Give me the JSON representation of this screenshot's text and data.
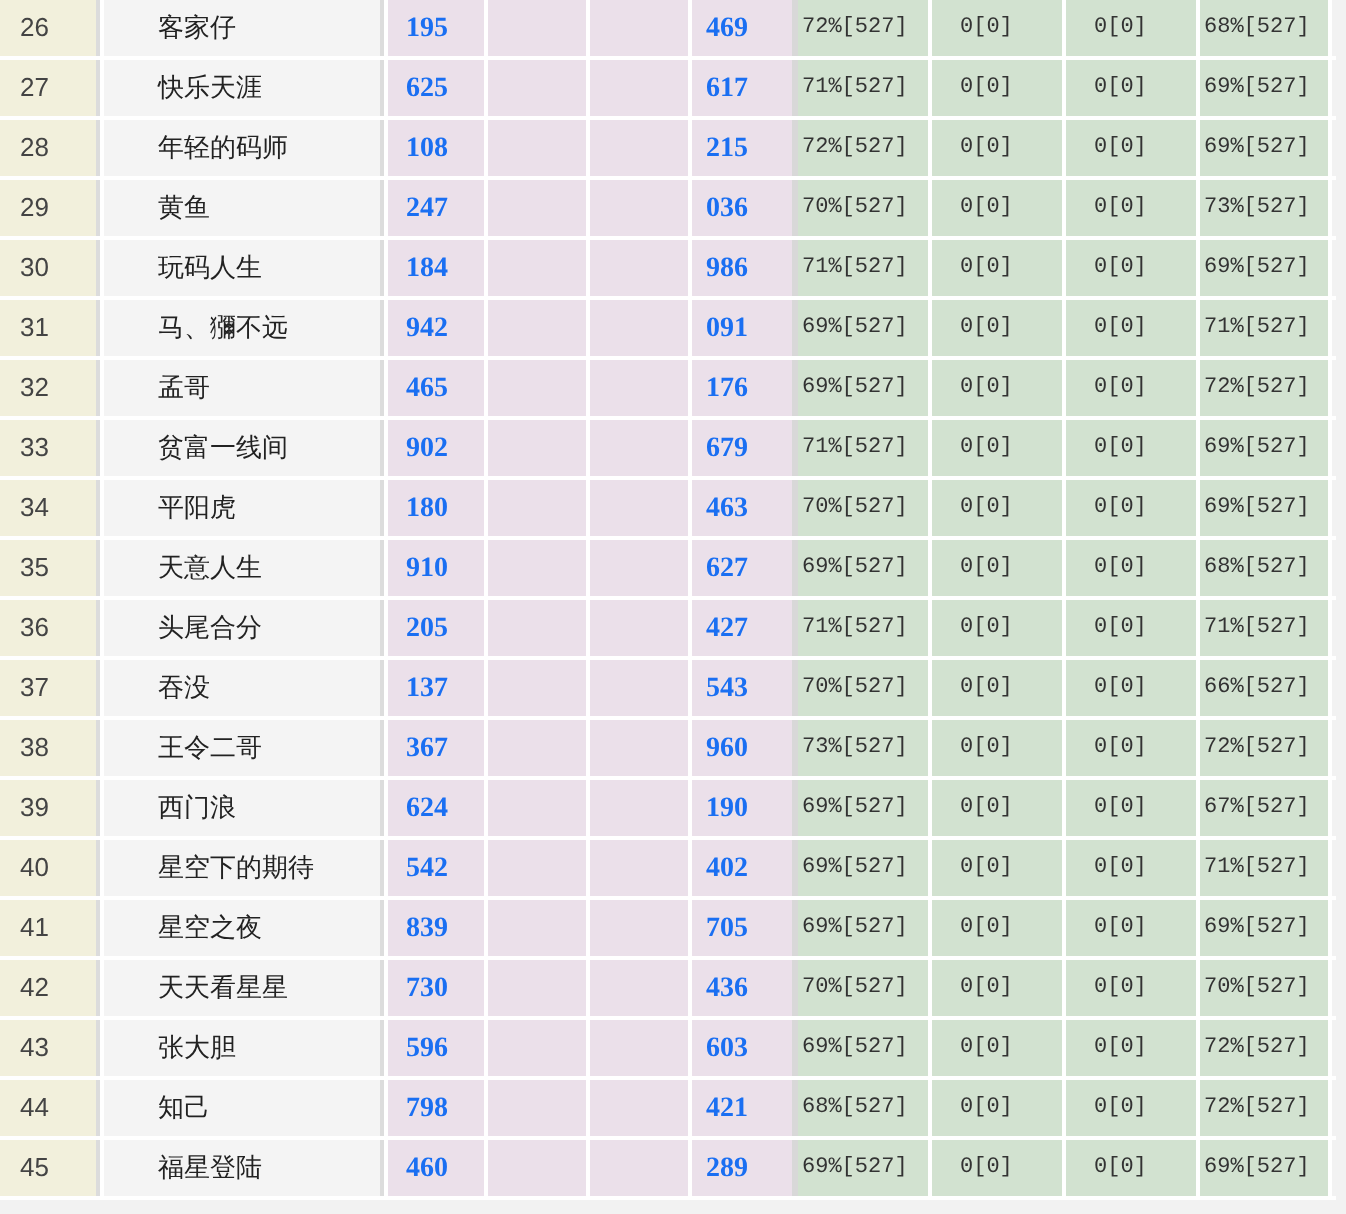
{
  "table": {
    "rows": [
      {
        "rank": "26",
        "name": "客家仔",
        "value_1": "195",
        "value_2": "469",
        "stats": [
          "72%[527]",
          "0[0]",
          "0[0]",
          "68%[527]"
        ]
      },
      {
        "rank": "27",
        "name": "快乐天涯",
        "value_1": "625",
        "value_2": "617",
        "stats": [
          "71%[527]",
          "0[0]",
          "0[0]",
          "69%[527]"
        ]
      },
      {
        "rank": "28",
        "name": "年轻的码师",
        "value_1": "108",
        "value_2": "215",
        "stats": [
          "72%[527]",
          "0[0]",
          "0[0]",
          "69%[527]"
        ]
      },
      {
        "rank": "29",
        "name": "黄鱼",
        "value_1": "247",
        "value_2": "036",
        "stats": [
          "70%[527]",
          "0[0]",
          "0[0]",
          "73%[527]"
        ]
      },
      {
        "rank": "30",
        "name": "玩码人生",
        "value_1": "184",
        "value_2": "986",
        "stats": [
          "71%[527]",
          "0[0]",
          "0[0]",
          "69%[527]"
        ]
      },
      {
        "rank": "31",
        "name": "马、獼不远",
        "value_1": "942",
        "value_2": "091",
        "stats": [
          "69%[527]",
          "0[0]",
          "0[0]",
          "71%[527]"
        ]
      },
      {
        "rank": "32",
        "name": "孟哥",
        "value_1": "465",
        "value_2": "176",
        "stats": [
          "69%[527]",
          "0[0]",
          "0[0]",
          "72%[527]"
        ]
      },
      {
        "rank": "33",
        "name": "贫富一线间",
        "value_1": "902",
        "value_2": "679",
        "stats": [
          "71%[527]",
          "0[0]",
          "0[0]",
          "69%[527]"
        ]
      },
      {
        "rank": "34",
        "name": "平阳虎",
        "value_1": "180",
        "value_2": "463",
        "stats": [
          "70%[527]",
          "0[0]",
          "0[0]",
          "69%[527]"
        ]
      },
      {
        "rank": "35",
        "name": "天意人生",
        "value_1": "910",
        "value_2": "627",
        "stats": [
          "69%[527]",
          "0[0]",
          "0[0]",
          "68%[527]"
        ]
      },
      {
        "rank": "36",
        "name": "头尾合分",
        "value_1": "205",
        "value_2": "427",
        "stats": [
          "71%[527]",
          "0[0]",
          "0[0]",
          "71%[527]"
        ]
      },
      {
        "rank": "37",
        "name": "吞没",
        "value_1": "137",
        "value_2": "543",
        "stats": [
          "70%[527]",
          "0[0]",
          "0[0]",
          "66%[527]"
        ]
      },
      {
        "rank": "38",
        "name": "王令二哥",
        "value_1": "367",
        "value_2": "960",
        "stats": [
          "73%[527]",
          "0[0]",
          "0[0]",
          "72%[527]"
        ]
      },
      {
        "rank": "39",
        "name": "西门浪",
        "value_1": "624",
        "value_2": "190",
        "stats": [
          "69%[527]",
          "0[0]",
          "0[0]",
          "67%[527]"
        ]
      },
      {
        "rank": "40",
        "name": "星空下的期待",
        "value_1": "542",
        "value_2": "402",
        "stats": [
          "69%[527]",
          "0[0]",
          "0[0]",
          "71%[527]"
        ]
      },
      {
        "rank": "41",
        "name": "星空之夜",
        "value_1": "839",
        "value_2": "705",
        "stats": [
          "69%[527]",
          "0[0]",
          "0[0]",
          "69%[527]"
        ]
      },
      {
        "rank": "42",
        "name": "天天看星星",
        "value_1": "730",
        "value_2": "436",
        "stats": [
          "70%[527]",
          "0[0]",
          "0[0]",
          "70%[527]"
        ]
      },
      {
        "rank": "43",
        "name": "张大胆",
        "value_1": "596",
        "value_2": "603",
        "stats": [
          "69%[527]",
          "0[0]",
          "0[0]",
          "72%[527]"
        ]
      },
      {
        "rank": "44",
        "name": "知己",
        "value_1": "798",
        "value_2": "421",
        "stats": [
          "68%[527]",
          "0[0]",
          "0[0]",
          "72%[527]"
        ]
      },
      {
        "rank": "45",
        "name": "福星登陆",
        "value_1": "460",
        "value_2": "289",
        "stats": [
          "69%[527]",
          "0[0]",
          "0[0]",
          "69%[527]"
        ]
      }
    ]
  }
}
